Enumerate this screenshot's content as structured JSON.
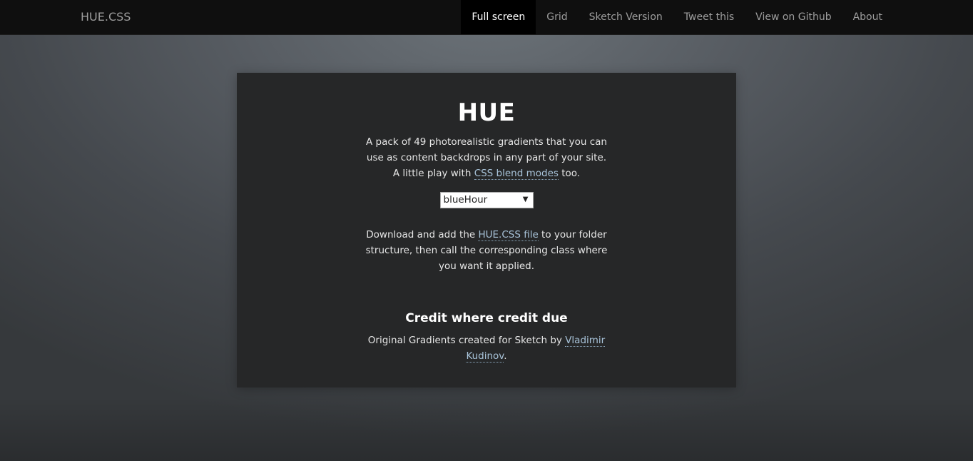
{
  "navbar": {
    "brand": "HUE.CSS",
    "items": [
      {
        "label": "Full screen",
        "active": true
      },
      {
        "label": "Grid"
      },
      {
        "label": "Sketch Version"
      },
      {
        "label": "Tweet this"
      },
      {
        "label": "View on Github"
      },
      {
        "label": "About"
      }
    ]
  },
  "main": {
    "title": "HUE",
    "description_prefix": "A pack of 49 photorealistic gradients that you can use as content backdrops in any part of your site. A little play with ",
    "description_link": "CSS blend modes",
    "description_suffix": " too.",
    "select": {
      "selected": "blueHour",
      "arrow_icon": "triangle-down-icon"
    },
    "download_prefix": "Download and add the ",
    "download_link": "HUE.CSS file",
    "download_suffix": " to your folder structure, then call the corresponding class where you want it applied.",
    "credit_title": "Credit where credit due",
    "credit_prefix": "Original Gradients created for Sketch by ",
    "credit_link": "Vladimir Kudinov",
    "credit_suffix": "."
  },
  "colors": {
    "navbar_bg": "#0f0f0f",
    "nav_active_bg": "#000000",
    "panel_bg": "#262728",
    "link": "#a8c3d9"
  }
}
